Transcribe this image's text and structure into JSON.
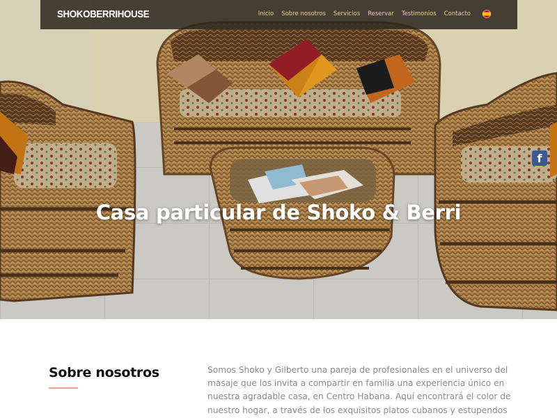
{
  "navbar": {
    "brand": "SHOKOBERRIHOUSE",
    "links": [
      {
        "label": "Inicio"
      },
      {
        "label": "Sobre nosotros"
      },
      {
        "label": "Servicios"
      },
      {
        "label": "Reservar"
      },
      {
        "label": "Testimonios"
      },
      {
        "label": "Contacto"
      }
    ],
    "language_flag": "spain-flag-icon"
  },
  "hero": {
    "title": "Casa particular de Shoko & Berri",
    "social_icon": "facebook-icon"
  },
  "about": {
    "heading": "Sobre nosotros",
    "text": "Somos Shoko y Gilberto una pareja de profesionales en el universo del masaje que los invita a compartir en familia una experiencia único en nuestra agradable casa, en Centro Habana. Aquí encontrará el color de nuestro hogar, a través de los exquisitos platos cubanos y estupendos masajes"
  },
  "colors": {
    "nav_background": "#2c261e",
    "nav_link": "#f0d68a",
    "accent_underline": "#f2a08c",
    "body_text": "#8a8a8a",
    "facebook": "#3b5998"
  }
}
